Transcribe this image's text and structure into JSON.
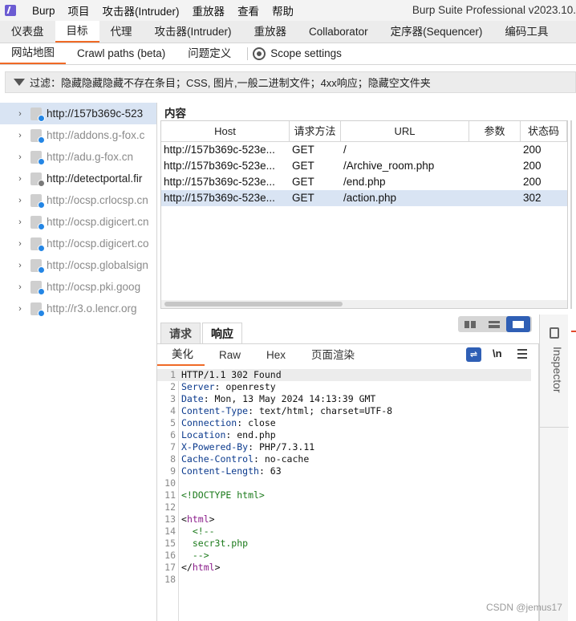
{
  "menubar": {
    "items": [
      "Burp",
      "项目",
      "攻击器(Intruder)",
      "重放器",
      "查看",
      "帮助"
    ],
    "title": "Burp Suite Professional v2023.10."
  },
  "main_tabs": [
    "仪表盘",
    "目标",
    "代理",
    "攻击器(Intruder)",
    "重放器",
    "Collaborator",
    "定序器(Sequencer)",
    "编码工具"
  ],
  "active_main_tab": "目标",
  "sub_tabs": {
    "site_map": "网站地图",
    "crawl_paths": "Crawl paths (beta)",
    "issue_defs": "问题定义",
    "scope_settings": "Scope settings"
  },
  "filter": {
    "text": "过滤：隐藏隐藏隐藏不存在条目；CSS, 图片,一般二进制文件；4xx响应；隐藏空文件夹"
  },
  "site_tree": [
    {
      "label": "http://157b369c-523",
      "selected": true,
      "dark": true,
      "dot": "blue"
    },
    {
      "label": "http://addons.g-fox.c",
      "selected": false,
      "dark": false,
      "dot": "blue"
    },
    {
      "label": "http://adu.g-fox.cn",
      "selected": false,
      "dark": false,
      "dot": "blue"
    },
    {
      "label": "http://detectportal.fir",
      "selected": false,
      "dark": true,
      "dot": "gray"
    },
    {
      "label": "http://ocsp.crlocsp.cn",
      "selected": false,
      "dark": false,
      "dot": "blue"
    },
    {
      "label": "http://ocsp.digicert.cn",
      "selected": false,
      "dark": false,
      "dot": "blue"
    },
    {
      "label": "http://ocsp.digicert.co",
      "selected": false,
      "dark": false,
      "dot": "blue"
    },
    {
      "label": "http://ocsp.globalsign",
      "selected": false,
      "dark": false,
      "dot": "blue"
    },
    {
      "label": "http://ocsp.pki.goog",
      "selected": false,
      "dark": false,
      "dot": "blue"
    },
    {
      "label": "http://r3.o.lencr.org",
      "selected": false,
      "dark": false,
      "dot": "blue"
    }
  ],
  "content": {
    "title": "内容",
    "columns": [
      "Host",
      "请求方法",
      "URL",
      "参数",
      "状态码"
    ],
    "rows": [
      {
        "host": "http://157b369c-523e...",
        "method": "GET",
        "url": "/",
        "params": "",
        "status": "200",
        "selected": false
      },
      {
        "host": "http://157b369c-523e...",
        "method": "GET",
        "url": "/Archive_room.php",
        "params": "",
        "status": "200",
        "selected": false
      },
      {
        "host": "http://157b369c-523e...",
        "method": "GET",
        "url": "/end.php",
        "params": "",
        "status": "200",
        "selected": false
      },
      {
        "host": "http://157b369c-523e...",
        "method": "GET",
        "url": "/action.php",
        "params": "",
        "status": "302",
        "selected": true
      }
    ]
  },
  "rr_tabs": {
    "request": "请求",
    "response": "响应"
  },
  "view_tabs": {
    "pretty": "美化",
    "raw": "Raw",
    "hex": "Hex",
    "render": "页面渲染"
  },
  "newline_label": "\\n",
  "response_lines": [
    [
      {
        "c": "v",
        "t": "HTTP/1.1 302 Found"
      }
    ],
    [
      {
        "c": "k",
        "t": "Server"
      },
      {
        "c": "v",
        "t": ": openresty"
      }
    ],
    [
      {
        "c": "k",
        "t": "Date"
      },
      {
        "c": "v",
        "t": ": Mon, 13 May 2024 14:13:39 GMT"
      }
    ],
    [
      {
        "c": "k",
        "t": "Content-Type"
      },
      {
        "c": "v",
        "t": ": text/html; charset=UTF-8"
      }
    ],
    [
      {
        "c": "k",
        "t": "Connection"
      },
      {
        "c": "v",
        "t": ": close"
      }
    ],
    [
      {
        "c": "k",
        "t": "Location"
      },
      {
        "c": "v",
        "t": ": end.php"
      }
    ],
    [
      {
        "c": "k",
        "t": "X-Powered-By"
      },
      {
        "c": "v",
        "t": ": PHP/7.3.11"
      }
    ],
    [
      {
        "c": "k",
        "t": "Cache-Control"
      },
      {
        "c": "v",
        "t": ": no-cache"
      }
    ],
    [
      {
        "c": "k",
        "t": "Content-Length"
      },
      {
        "c": "v",
        "t": ": 63"
      }
    ],
    [],
    [
      {
        "c": "cmt",
        "t": "<!DOCTYPE html>"
      }
    ],
    [],
    [
      {
        "c": "v",
        "t": "<"
      },
      {
        "c": "tag",
        "t": "html"
      },
      {
        "c": "v",
        "t": ">"
      }
    ],
    [
      {
        "c": "cmt",
        "t": "  <!--"
      }
    ],
    [
      {
        "c": "cmt",
        "t": "  secr3t.php"
      }
    ],
    [
      {
        "c": "cmt",
        "t": "  -->"
      }
    ],
    [
      {
        "c": "v",
        "t": "</"
      },
      {
        "c": "tag",
        "t": "html"
      },
      {
        "c": "v",
        "t": ">"
      }
    ],
    []
  ],
  "inspector_label": "Inspector",
  "watermark": "CSDN @jemus17"
}
